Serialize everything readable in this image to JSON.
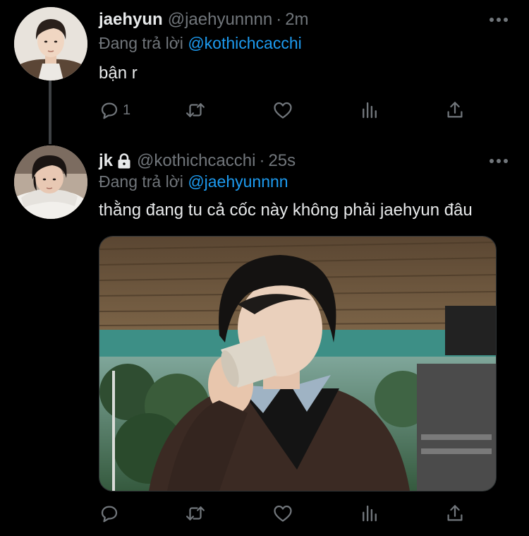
{
  "tweet1": {
    "name": "jaehyun",
    "handle": "@jaehyunnnn",
    "dot": "·",
    "time": "2m",
    "reply_prefix": "Đang trả lời ",
    "reply_mention": "@kothichcacchi",
    "text": "bận r",
    "reply_count": "1",
    "actions": {
      "reply_icon": "reply-icon",
      "retweet_icon": "retweet-icon",
      "like_icon": "like-icon",
      "views_icon": "views-icon",
      "share_icon": "share-icon"
    }
  },
  "tweet2": {
    "name": "jk",
    "protected_icon": "lock-icon",
    "handle": "@kothichcacchi",
    "dot": "·",
    "time": "25s",
    "reply_prefix": "Đang trả lời ",
    "reply_mention": "@jaehyunnnn",
    "text": "thằng đang tu cả cốc này không phải jaehyun đâu",
    "media": "photo",
    "actions": {
      "reply_icon": "reply-icon",
      "retweet_icon": "retweet-icon",
      "like_icon": "like-icon",
      "views_icon": "views-icon",
      "share_icon": "share-icon"
    }
  },
  "colors": {
    "background": "#000000",
    "text": "#e7e9ea",
    "muted": "#71767b",
    "accent": "#1d9bf0"
  }
}
